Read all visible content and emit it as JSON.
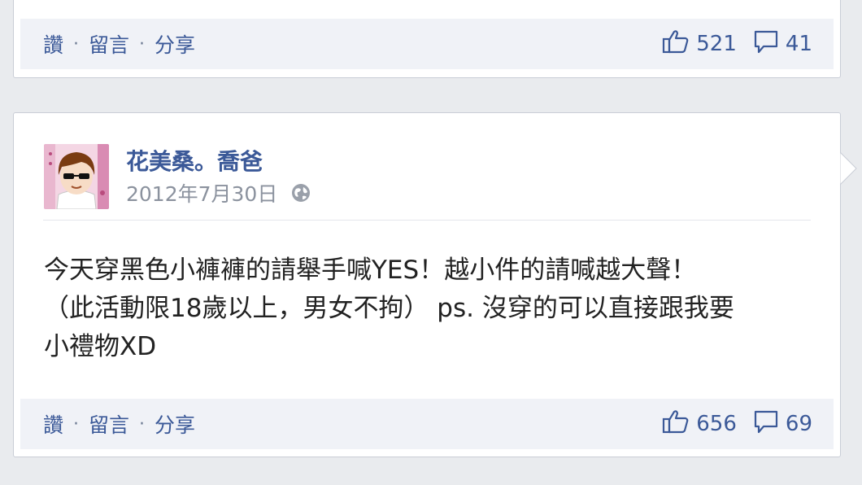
{
  "posts": [
    {
      "actions": {
        "like": "讚",
        "separator": "·",
        "comment": "留言",
        "share": "分享"
      },
      "likes": "521",
      "comments": "41"
    },
    {
      "author": "花美桑。喬爸",
      "date": "2012年7月30日",
      "text_lines": [
        "今天穿黑色小褲褲的請舉手喊YES！越小件的請喊越大聲！",
        "（此活動限18歲以上，男女不拘） ps. 沒穿的可以直接跟我要",
        "小禮物XD"
      ],
      "actions": {
        "like": "讚",
        "separator": "·",
        "comment": "留言",
        "share": "分享"
      },
      "likes": "656",
      "comments": "69"
    }
  ],
  "colors": {
    "link": "#3b5998",
    "action_bar": "#f0f2f7",
    "background": "#e9ebee"
  },
  "icons": {
    "like": "thumbs-up-icon",
    "comment": "comment-bubble-icon",
    "privacy": "globe-icon"
  }
}
